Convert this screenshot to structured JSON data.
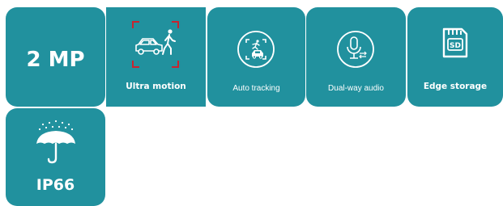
{
  "colors": {
    "tile": "#21919e",
    "accent": "#c8242f",
    "text": "#ffffff"
  },
  "features": [
    {
      "icon": "resolution",
      "label": "2 MP"
    },
    {
      "icon": "car-pedestrian-icon",
      "label": "Ultra motion"
    },
    {
      "icon": "auto-tracking-icon",
      "label": "Auto tracking"
    },
    {
      "icon": "microphone-icon",
      "label": "Dual-way audio"
    },
    {
      "icon": "sd-card-icon",
      "label": "Edge storage"
    },
    {
      "icon": "umbrella-rain-icon",
      "label": "IP66"
    }
  ]
}
